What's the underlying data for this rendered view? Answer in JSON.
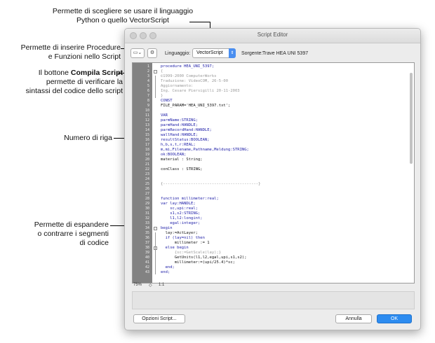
{
  "callouts": {
    "language_line1": "Permette di scegliere se usare il linguaggio",
    "language_line2": "Python o quello VectorScript",
    "procedures_line1": "Permette di inserire Procedure",
    "procedures_line2": "e Funzioni nello Script",
    "compile_bold": "Compila Script",
    "compile_pre": "Il bottone ",
    "compile_line2": "permette di verificare la",
    "compile_line3": "sintassi del codice dello script",
    "line_number": "Numero di riga",
    "fold_line1": "Permette di espandere",
    "fold_line2": "o contrarre i segmenti",
    "fold_line3": "di codice"
  },
  "window": {
    "title": "Script Editor",
    "language_label": "Linguaggio:",
    "language_value": "VectorScript",
    "source_label": "Sorgente:",
    "source_value": "Trave HEA UNI 5397",
    "zoom": "75%",
    "position": "1:1",
    "options_button": "Opzioni Script...",
    "cancel_button": "Annulla",
    "ok_button": "OK"
  },
  "code": {
    "line_numbers": [
      "1",
      "2",
      "3",
      "4",
      "5",
      "6",
      "7",
      "8",
      "9",
      "10",
      "11",
      "12",
      "13",
      "14",
      "15",
      "16",
      "17",
      "18",
      "19",
      "20",
      "21",
      "22",
      "23",
      "24",
      "25",
      "26",
      "27",
      "28",
      "29",
      "30",
      "31",
      "32",
      "33",
      "34",
      "35",
      "36",
      "37",
      "38",
      "39",
      "40",
      "41",
      "42",
      "43"
    ],
    "lines": [
      "procedure HEA_UNI_5397;",
      "{",
      "©1999-2000 ComputerWorks",
      "Traduzione: VideoCOM, 26-5-00",
      "Aggiornamento:",
      "Ing. Cesare Piersigilli 20-11-2003",
      "}",
      "CONST",
      "FILE_PARAM='HEA_UNI_5397.txt';",
      "",
      "VAR",
      "parmName:STRING;",
      "parmHand:HANDLE;",
      "parmRecordHand:HANDLE;",
      "wallHand:HANDLE;",
      "resultStatus:BOOLEAN;",
      "h,b,s,t,r:REAL;",
      "m,mi,Filename,Pathname,Meldung:STRING;",
      "ok:BOOLEAN;",
      "material : String;",
      "",
      "conClass : STRING;",
      "",
      "",
      "{-----------------------------------------}",
      "",
      "",
      "function millimeter:real;",
      "var lay:HANDLE;",
      "    sc,upi:real;",
      "    s1,s2:STRING;",
      "    l1,l2:longint;",
      "    egal:integer;",
      "begin",
      "  lay:=ActLayer;",
      "  if (lay=nil) then",
      "      millimeter := 1",
      "  else begin",
      "      {sc:=GetScale(lay);}",
      "      GetUnits(l1,l2,egal,upi,s1,s2);",
      "      millimeter:=(upi/25.4)*sc;",
      "  end;",
      "end;"
    ]
  }
}
